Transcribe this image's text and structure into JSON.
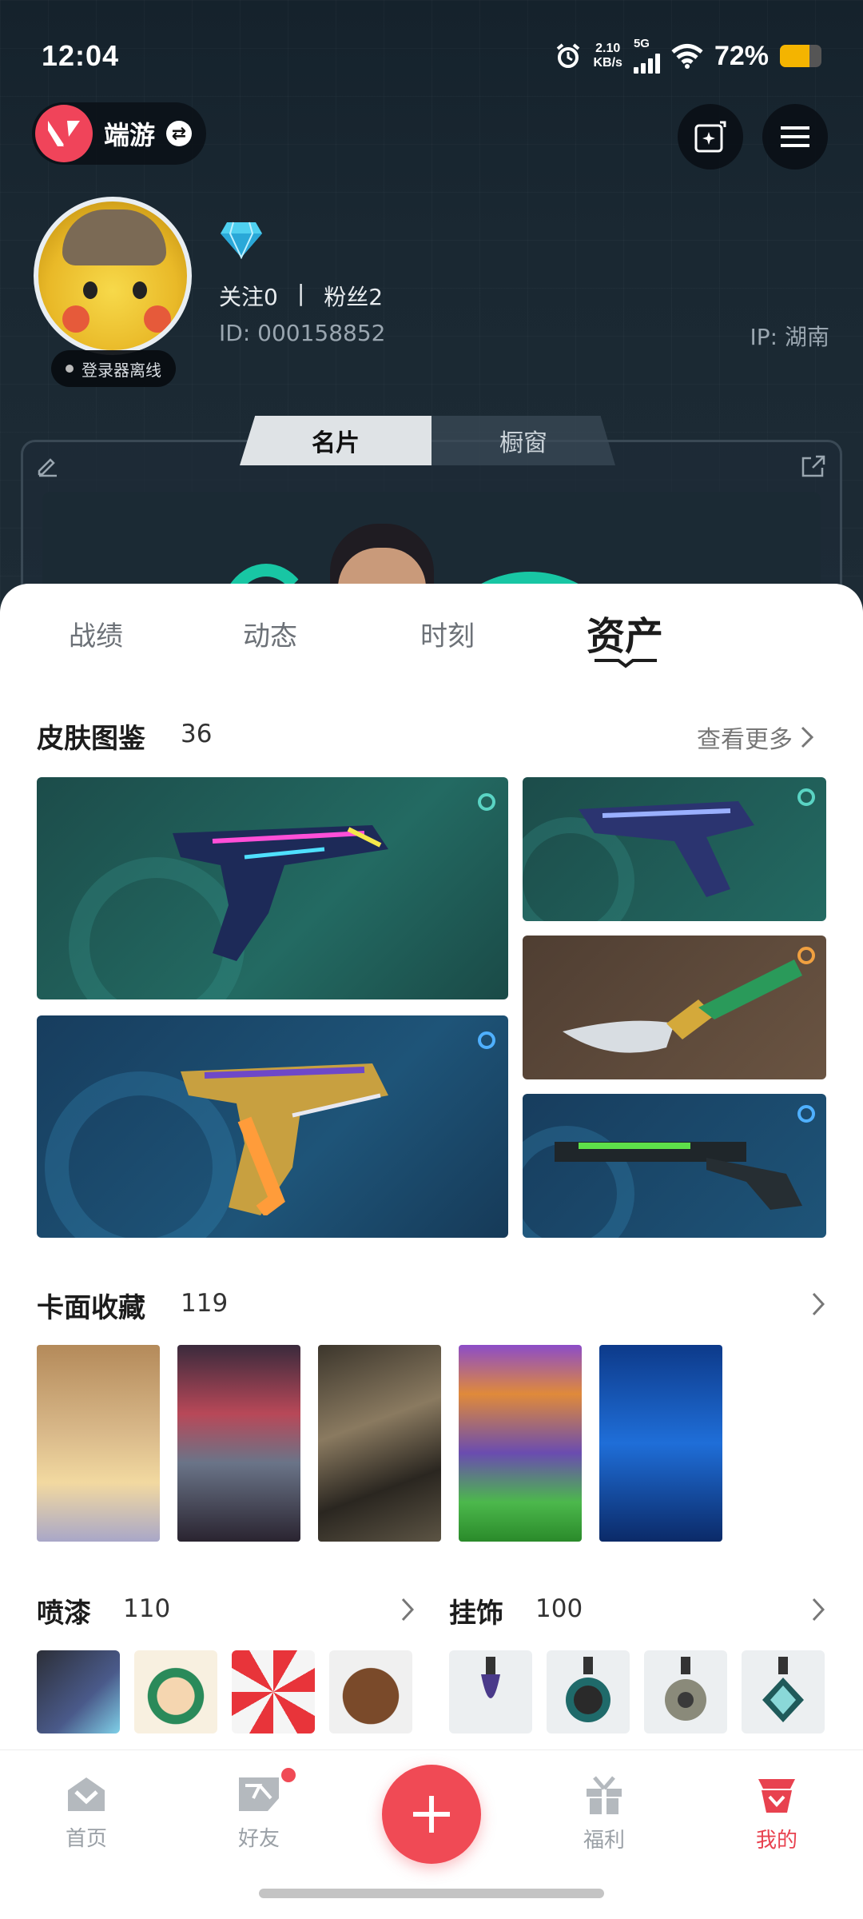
{
  "status_bar": {
    "time": "12:04",
    "net_speed_value": "2.10",
    "net_speed_unit": "KB/s",
    "network": "5G",
    "battery_pct": "72%",
    "battery_level": 0.72
  },
  "header": {
    "app_name": "端游",
    "diamond_icon": "diamond-icon"
  },
  "profile": {
    "following": "关注0",
    "separator": "|",
    "followers": "粉丝2",
    "id": "ID:  000158852",
    "ip": "IP:  湖南",
    "status": "登录器离线"
  },
  "card_tabs": [
    "名片",
    "橱窗"
  ],
  "main_tabs": [
    "战绩",
    "动态",
    "时刻",
    "资产"
  ],
  "sections": {
    "skins": {
      "title": "皮肤图鉴",
      "count": "36",
      "more": "查看更多"
    },
    "cards": {
      "title": "卡面收藏",
      "count": "119"
    },
    "sprays": {
      "title": "喷漆",
      "count": "110"
    },
    "charms": {
      "title": "挂饰",
      "count": "100"
    }
  },
  "colors": {
    "accent": "#f04a55",
    "skin_teal": "#1d5a55",
    "skin_blue": "#1d4f6e",
    "skin_brown": "#5a4636"
  },
  "bottom_nav": [
    {
      "label": "首页",
      "icon": "home-icon"
    },
    {
      "label": "好友",
      "icon": "friends-icon"
    },
    {
      "label": "福利",
      "icon": "gift-icon"
    },
    {
      "label": "我的",
      "icon": "profile-icon"
    }
  ]
}
